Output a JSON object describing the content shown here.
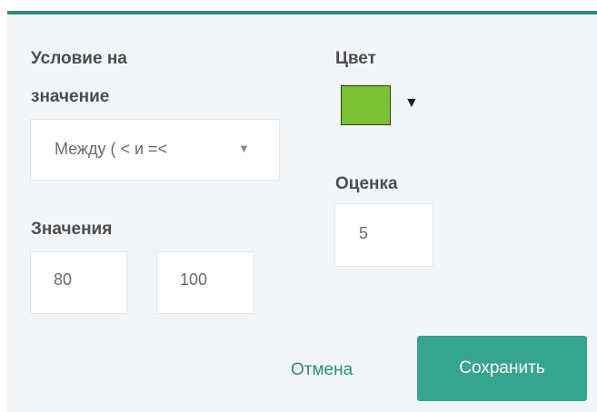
{
  "condition": {
    "label_line1": "Условие на",
    "label_line2": "значение",
    "selected_option": "Между ( < и =<",
    "arrow_icon": "triangle-down-icon"
  },
  "values": {
    "label": "Значения",
    "min": "80",
    "max": "100"
  },
  "color": {
    "label": "Цвет",
    "selected_color": "#7ac231",
    "arrow_icon": "triangle-down-icon"
  },
  "score": {
    "label": "Оценка",
    "value": "5"
  },
  "actions": {
    "cancel_label": "Отмена",
    "save_label": "Сохранить"
  },
  "theme": {
    "accent": "#36a58d",
    "top_border": "#2e8c78",
    "panel_bg": "#f3f6f9"
  }
}
